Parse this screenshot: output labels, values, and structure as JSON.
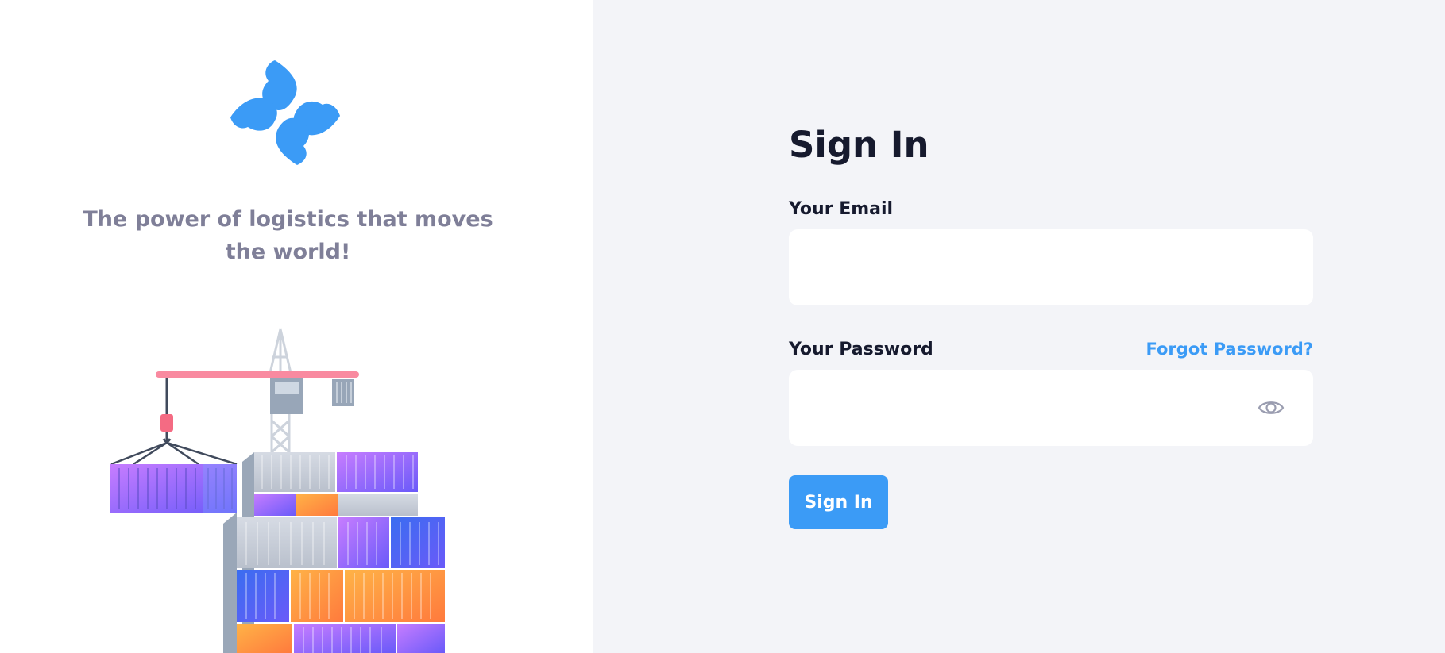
{
  "brand": {
    "logo_icon": "four-petal-flower-logo",
    "accent_color": "#3b9bf6",
    "tagline": "The power of logistics that moves the world!"
  },
  "illustration": {
    "icon": "cargo-crane-containers-illustration"
  },
  "signin": {
    "title": "Sign In",
    "email_label": "Your Email",
    "email_value": "",
    "email_placeholder": "",
    "password_label": "Your Password",
    "password_value": "",
    "password_placeholder": "",
    "forgot_label": "Forgot Password?",
    "show_password_icon": "eye-icon",
    "submit_label": "Sign In"
  }
}
